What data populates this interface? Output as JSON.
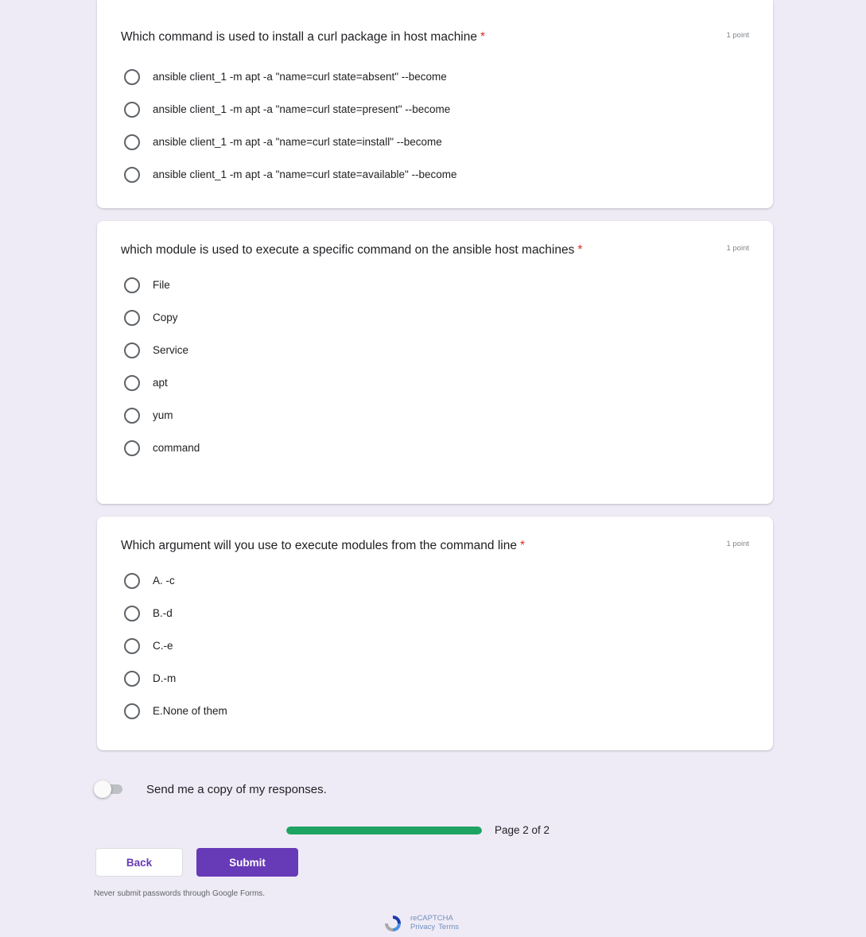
{
  "questions": [
    {
      "title": "Which command is used to install a curl package in host machine",
      "required_mark": "*",
      "points": "1 point",
      "options": [
        "ansible client_1 -m apt -a \"name=curl state=absent\" --become",
        "ansible client_1 -m apt -a \"name=curl state=present\" --become",
        "ansible client_1 -m apt -a \"name=curl state=install\" --become",
        "ansible client_1 -m apt -a \"name=curl state=available\" --become"
      ]
    },
    {
      "title": "which module is used to execute a specific command on the ansible host machines",
      "required_mark": "*",
      "points": "1 point",
      "options": [
        "File",
        "Copy",
        "Service",
        "apt",
        "yum",
        "command"
      ]
    },
    {
      "title": "Which argument will you use to execute modules from the command line",
      "required_mark": "*",
      "points": "1 point",
      "options": [
        "A. -c",
        "B.-d",
        "C.-e",
        "D.-m",
        "E.None of them"
      ]
    }
  ],
  "send_copy": {
    "label": "Send me a copy of my responses.",
    "enabled": false
  },
  "progress": {
    "text": "Page 2 of 2",
    "fraction": 1.0
  },
  "buttons": {
    "back": "Back",
    "submit": "Submit"
  },
  "warning": "Never submit passwords through Google Forms.",
  "recaptcha": {
    "title": "reCAPTCHA",
    "privacy": "Privacy",
    "terms": "Terms"
  },
  "colors": {
    "accent": "#673ab7",
    "progress": "#1ea362",
    "required": "#d93025",
    "background": "#efebf6"
  }
}
